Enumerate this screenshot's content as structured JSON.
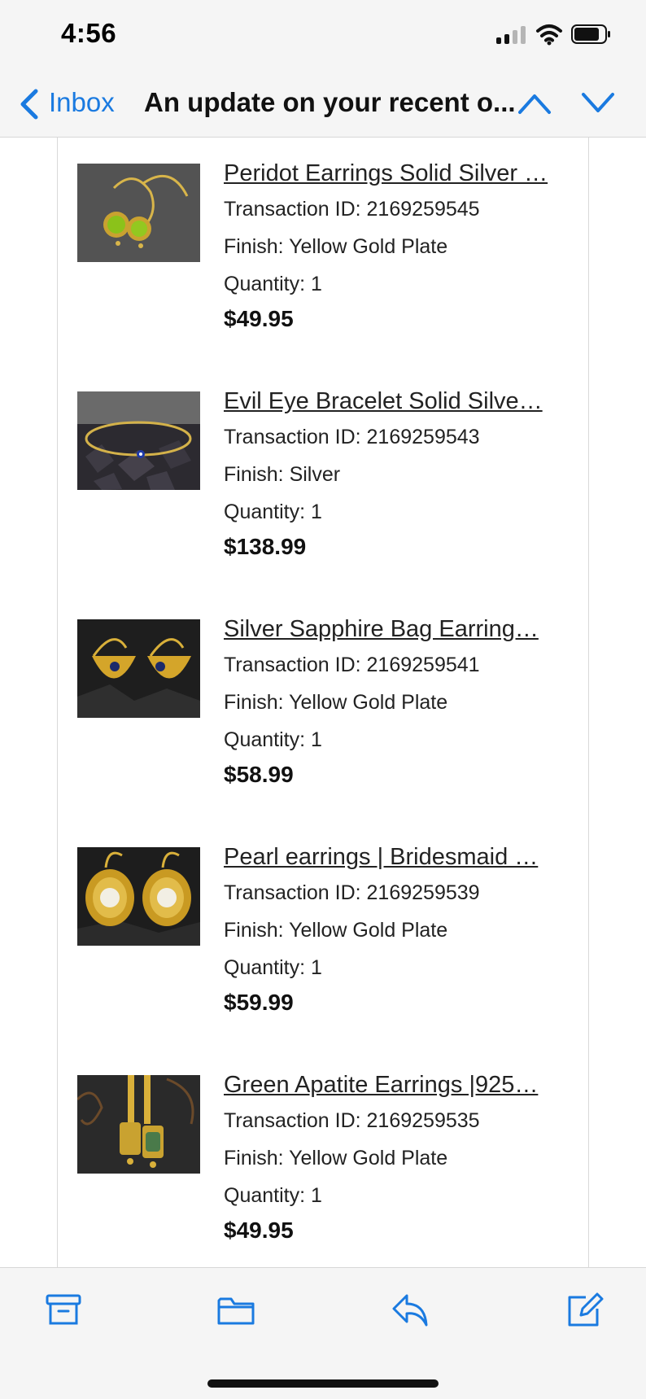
{
  "status_bar": {
    "time": "4:56"
  },
  "nav": {
    "back_label": "Inbox",
    "title": "An update on your recent o..."
  },
  "items": [
    {
      "title": "Peridot Earrings Solid Silver …",
      "transaction": "Transaction ID: 2169259545",
      "finish": "Finish: Yellow Gold Plate",
      "quantity": "Quantity: 1",
      "price": "$49.95"
    },
    {
      "title": "Evil Eye Bracelet Solid Silve…",
      "transaction": "Transaction ID: 2169259543",
      "finish": "Finish: Silver",
      "quantity": "Quantity: 1",
      "price": "$138.99"
    },
    {
      "title": "Silver Sapphire Bag Earring…",
      "transaction": "Transaction ID: 2169259541",
      "finish": "Finish: Yellow Gold Plate",
      "quantity": "Quantity: 1",
      "price": "$58.99"
    },
    {
      "title": "Pearl earrings | Bridesmaid …",
      "transaction": "Transaction ID: 2169259539",
      "finish": "Finish: Yellow Gold Plate",
      "quantity": "Quantity: 1",
      "price": "$59.99"
    },
    {
      "title": "Green Apatite Earrings |925…",
      "transaction": "Transaction ID: 2169259535",
      "finish": "Finish: Yellow Gold Plate",
      "quantity": "Quantity: 1",
      "price": "$49.95"
    }
  ],
  "toolbar": {
    "icons": [
      "archive-icon",
      "folder-icon",
      "reply-icon",
      "compose-icon"
    ]
  },
  "colors": {
    "accent": "#1a7ae0",
    "bar_background": "#f5f5f5",
    "text": "#222222"
  }
}
